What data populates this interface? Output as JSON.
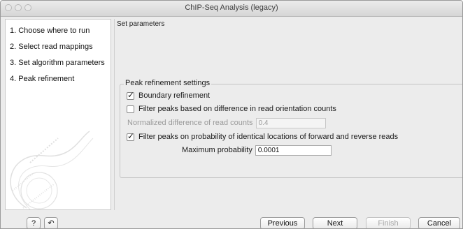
{
  "window": {
    "title": "ChIP-Seq Analysis (legacy)"
  },
  "steps": [
    {
      "label": "1.  Choose where to run"
    },
    {
      "label": "2.  Select read mappings"
    },
    {
      "label": "3.  Set algorithm parameters"
    },
    {
      "label": "4.  Peak refinement"
    }
  ],
  "content": {
    "section_heading": "Set parameters",
    "group": {
      "legend": "Peak refinement settings",
      "boundary_refinement": {
        "label": "Boundary refinement",
        "checked": true
      },
      "filter_orientation": {
        "label": "Filter peaks based on difference in read orientation counts",
        "checked": false
      },
      "normalized_difference": {
        "label": "Normalized difference of read counts",
        "value": "0.4",
        "enabled": false
      },
      "filter_probability": {
        "label": "Filter peaks on probability of identical locations of forward and reverse reads",
        "checked": true
      },
      "max_probability": {
        "label": "Maximum probability",
        "value": "0.0001"
      }
    }
  },
  "footer": {
    "help_icon": "?",
    "reset_icon": "↶",
    "previous": "Previous",
    "next": "Next",
    "finish": "Finish",
    "cancel": "Cancel"
  }
}
